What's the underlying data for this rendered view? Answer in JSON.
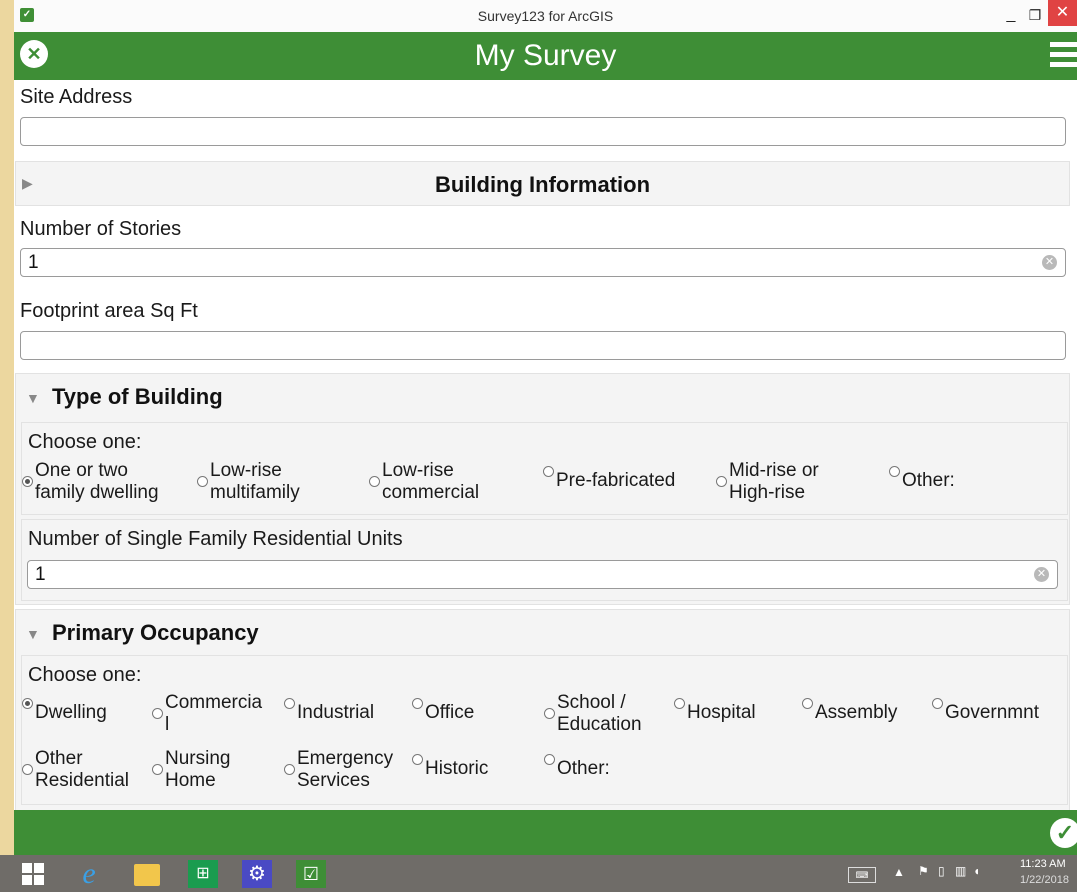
{
  "window": {
    "title": "Survey123 for ArcGIS",
    "min": "_",
    "max": "❐",
    "close": "✕"
  },
  "appbar": {
    "title": "My Survey",
    "close_icon": "close-icon",
    "menu_icon": "hamburger-menu-icon"
  },
  "form": {
    "site_address": {
      "label": "Site Address",
      "value": ""
    },
    "building_info": {
      "title": "Building Information"
    },
    "stories": {
      "label": "Number of Stories",
      "value": "1"
    },
    "footprint": {
      "label": "Footprint area Sq Ft",
      "value": ""
    },
    "type_of_building": {
      "title": "Type of Building",
      "choose": "Choose one:",
      "options": [
        {
          "line1": "One or two",
          "line2": "family dwelling",
          "selected": true
        },
        {
          "line1": "Low-rise",
          "line2": "multifamily",
          "selected": false
        },
        {
          "line1": "Low-rise",
          "line2": "commercial",
          "selected": false
        },
        {
          "line1": "Pre-fabricated",
          "line2": "",
          "selected": false
        },
        {
          "line1": "Mid-rise or",
          "line2": "High-rise",
          "selected": false
        },
        {
          "line1": "Other:",
          "line2": "",
          "selected": false
        }
      ]
    },
    "single_family_units": {
      "label": "Number of Single Family Residential Units",
      "value": "1"
    },
    "primary_occupancy": {
      "title": "Primary Occupancy",
      "choose": "Choose one:",
      "options_row1": [
        {
          "line1": "Dwelling",
          "line2": "",
          "selected": true
        },
        {
          "line1": "Commercia",
          "line2": "l",
          "selected": false
        },
        {
          "line1": "Industrial",
          "line2": "",
          "selected": false
        },
        {
          "line1": "Office",
          "line2": "",
          "selected": false
        },
        {
          "line1": "School /",
          "line2": "Education",
          "selected": false
        },
        {
          "line1": "Hospital",
          "line2": "",
          "selected": false
        },
        {
          "line1": "Assembly",
          "line2": "",
          "selected": false
        },
        {
          "line1": "Governmnt",
          "line2": "",
          "selected": false
        }
      ],
      "options_row2": [
        {
          "line1": "Other",
          "line2": "Residential",
          "selected": false
        },
        {
          "line1": "Nursing",
          "line2": "Home",
          "selected": false
        },
        {
          "line1": "Emergency",
          "line2": "Services",
          "selected": false
        },
        {
          "line1": "Historic",
          "line2": "",
          "selected": false
        },
        {
          "line1": "Other:",
          "line2": "",
          "selected": false
        }
      ]
    }
  },
  "bottombar": {
    "submit_icon": "checkmark-icon",
    "submit_glyph": "✓"
  },
  "taskbar": {
    "apps": [
      "start-icon",
      "internet-explorer-icon",
      "file-explorer-icon",
      "store-icon",
      "settings-icon",
      "survey123-icon"
    ],
    "time": "11:23 AM",
    "date": "1/22/2018"
  }
}
